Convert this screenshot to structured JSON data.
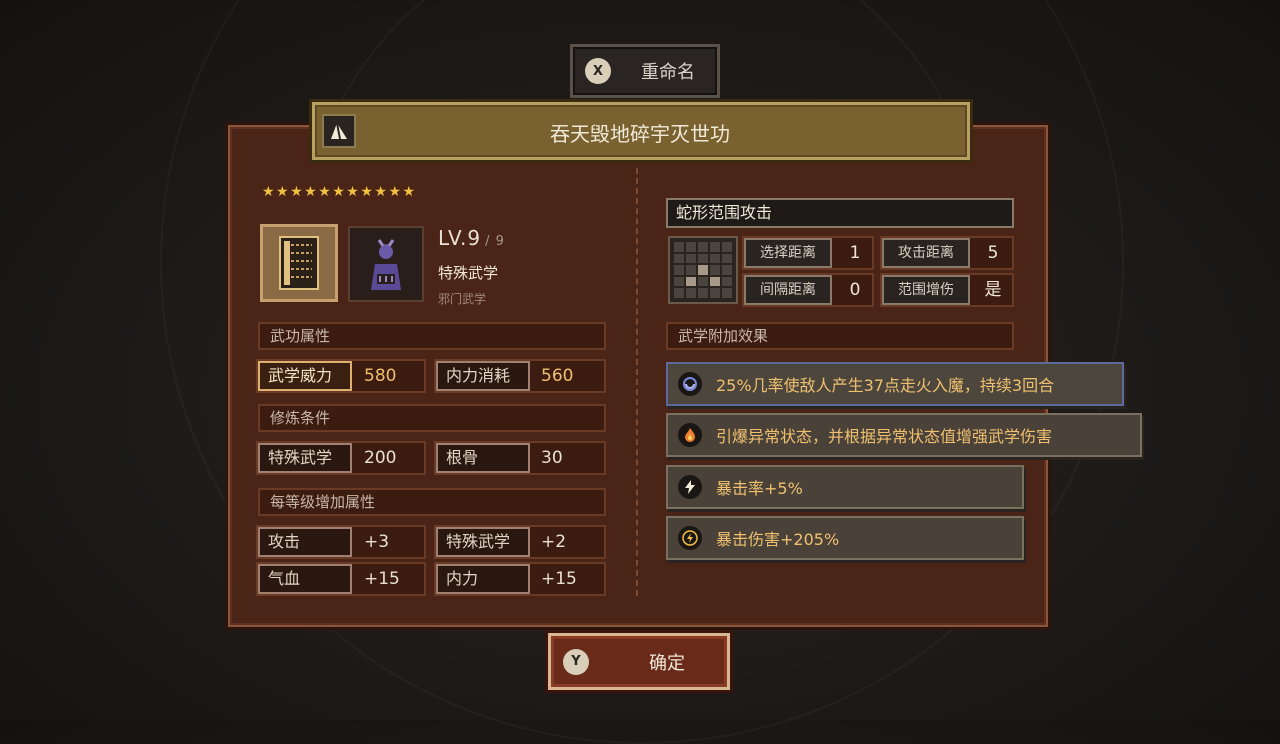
{
  "rename_button": {
    "key": "X",
    "label": "重命名"
  },
  "title": "吞天毁地碎宇灭世功",
  "stars": "★★★★★★★★★★★",
  "info": {
    "level": "LV.9",
    "level_max": "/ 9",
    "type": "特殊武学",
    "subtype": "邪门武学"
  },
  "sections": {
    "attributes": "武功属性",
    "requirements": "修炼条件",
    "per_level": "每等级增加属性"
  },
  "attributes": [
    {
      "label": "武学威力",
      "value": "580"
    },
    {
      "label": "内力消耗",
      "value": "560"
    }
  ],
  "requirements": [
    {
      "label": "特殊武学",
      "value": "200"
    },
    {
      "label": "根骨",
      "value": "30"
    }
  ],
  "per_level": [
    {
      "label": "攻击",
      "value": "+3"
    },
    {
      "label": "特殊武学",
      "value": "+2"
    },
    {
      "label": "气血",
      "value": "+15"
    },
    {
      "label": "内力",
      "value": "+15"
    }
  ],
  "skill": {
    "name": "蛇形范围攻击",
    "ranges": [
      {
        "label": "选择距离",
        "value": "1"
      },
      {
        "label": "攻击距离",
        "value": "5"
      },
      {
        "label": "间隔距离",
        "value": "0"
      },
      {
        "label": "范围增伤",
        "value": "是"
      }
    ],
    "effects_header": "武学附加效果",
    "effects": [
      {
        "icon": "swirl-icon",
        "text": "25%几率使敌人产生37点走火入魔，持续3回合"
      },
      {
        "icon": "fire-icon",
        "text": "引爆异常状态，并根据异常状态值增强武学伤害"
      },
      {
        "icon": "lightning-icon",
        "text": "暴击率+5%"
      },
      {
        "icon": "lightning-circle-icon",
        "text": "暴击伤害+205%"
      }
    ]
  },
  "confirm_button": {
    "key": "Y",
    "label": "确定"
  },
  "colors": {
    "panel": "#4a2416",
    "banner": "#7a6230",
    "gold_text": "#f0c070",
    "star": "#f0c040"
  }
}
